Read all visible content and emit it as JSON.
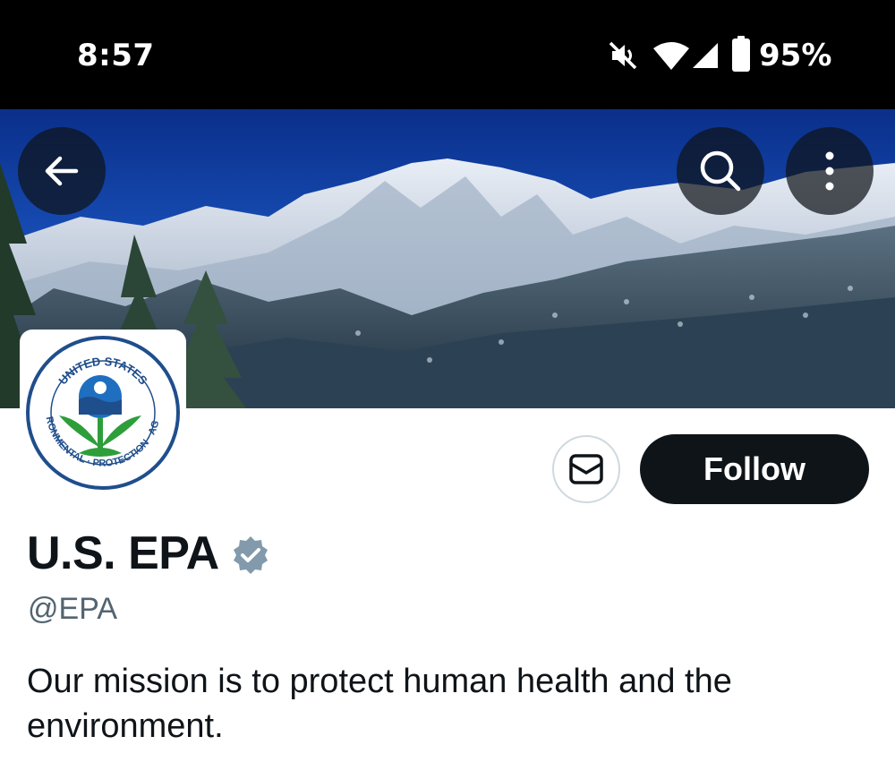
{
  "status_bar": {
    "time": "8:57",
    "battery_percent": "95%",
    "icons": [
      "mute-icon",
      "wifi-icon",
      "cell-signal-icon",
      "battery-icon"
    ]
  },
  "header": {
    "back_icon": "arrow-left-icon",
    "search_icon": "search-icon",
    "more_icon": "more-vertical-icon"
  },
  "avatar": {
    "seal_top": "UNITED STATES",
    "seal_left": "ENVIRONMENTAL",
    "seal_bottom": "PROTECTION",
    "seal_right": "AGENCY"
  },
  "actions": {
    "message_icon": "mail-icon",
    "follow_label": "Follow"
  },
  "profile": {
    "display_name": "U.S. EPA",
    "handle": "@EPA",
    "bio": "Our mission is to protect human health and the environment."
  },
  "colors": {
    "text_primary": "#0f1419",
    "text_secondary": "#536471",
    "verified_badge": "#829aab",
    "follow_bg": "#0f1419"
  }
}
